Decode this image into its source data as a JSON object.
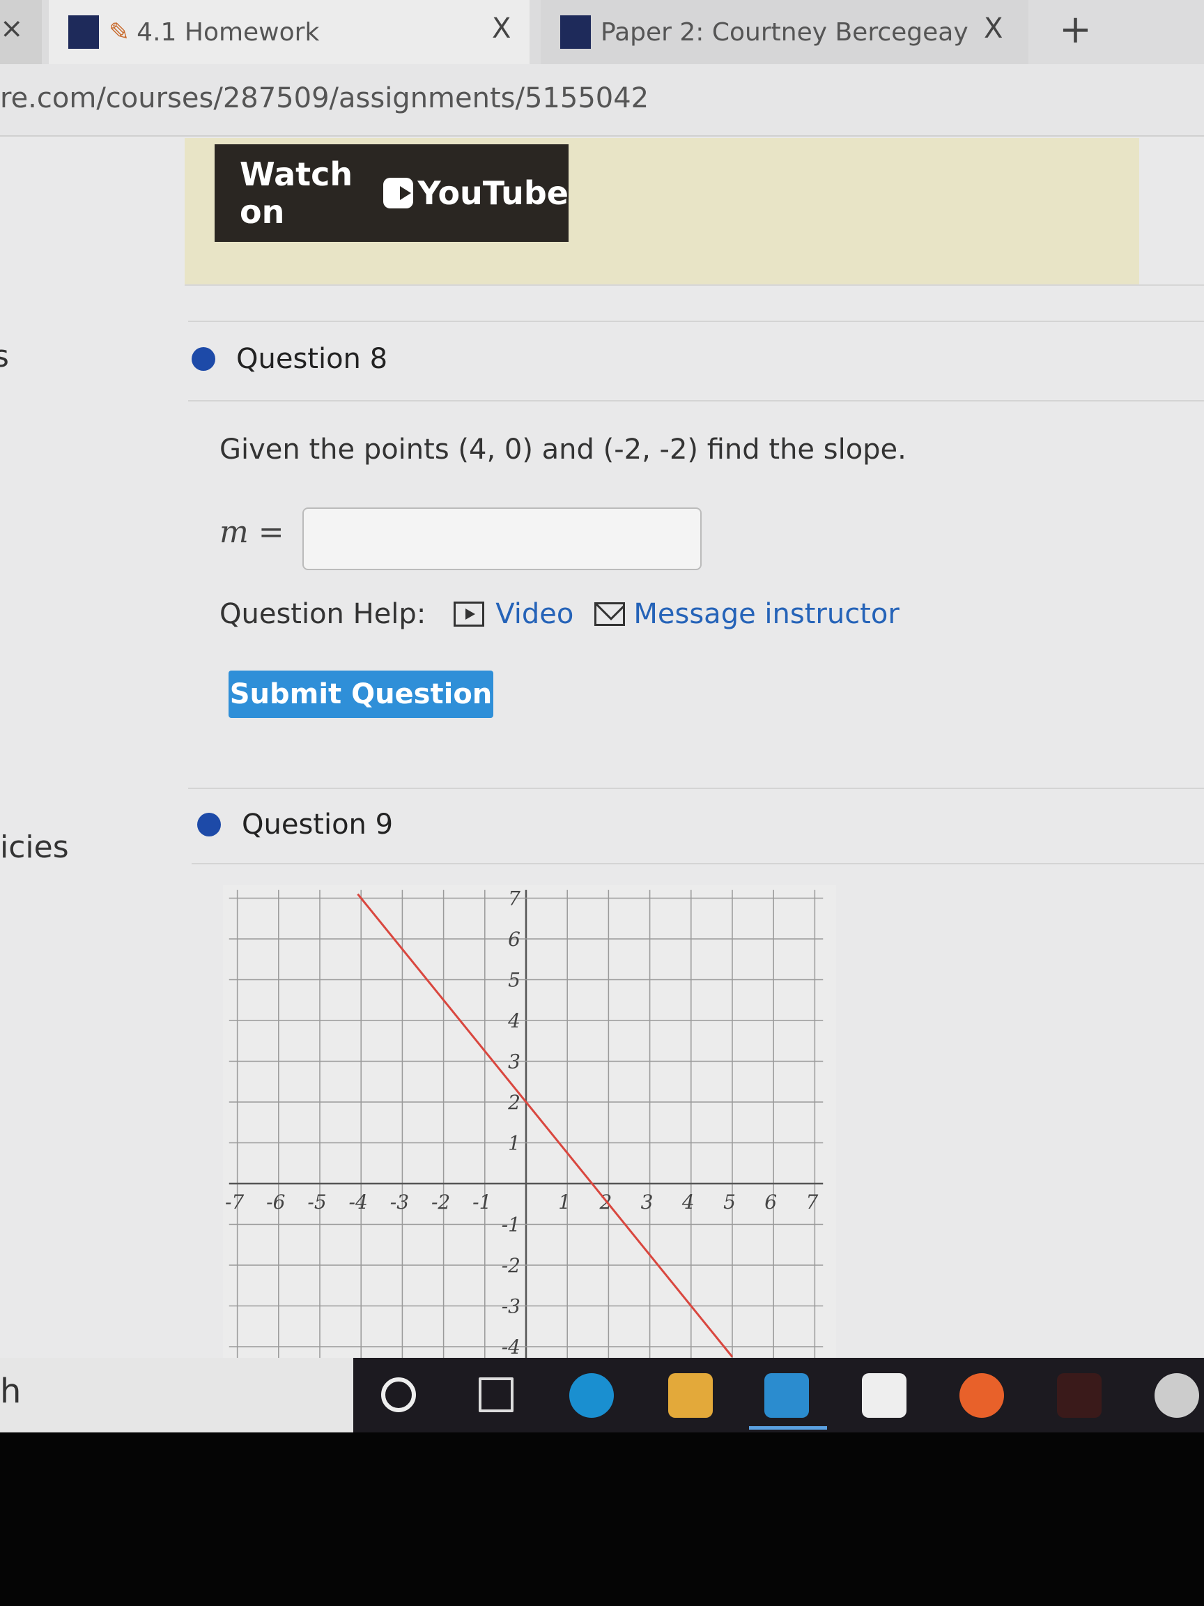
{
  "browser": {
    "tabs": [
      {
        "label": "4.1 Homework",
        "active": true
      },
      {
        "label": "Paper 2: Courtney Bercegeay",
        "active": false
      }
    ],
    "new_tab_label": "+",
    "close_label": "X",
    "url": "re.com/courses/287509/assignments/5155042"
  },
  "video_embed": {
    "watch_label": "Watch on",
    "brand": "YouTube"
  },
  "sidebar": {
    "items": [
      "s",
      "icies",
      "h"
    ]
  },
  "question8": {
    "title": "Question 8",
    "prompt": "Given the points (4, 0) and (-2, -2) find the slope.",
    "answer_label": "m =",
    "answer_value": "",
    "help_label": "Question Help:",
    "video_link": "Video",
    "message_link": "Message instructor",
    "submit_label": "Submit Question"
  },
  "question9": {
    "title": "Question 9"
  },
  "chart_data": {
    "type": "line",
    "xlim": [
      -7,
      7
    ],
    "ylim": [
      -4,
      7
    ],
    "grid": true,
    "x_ticks": [
      "-7",
      "-6",
      "-5",
      "-4",
      "-3",
      "-2",
      "-1",
      "1",
      "2",
      "3",
      "4",
      "5",
      "6",
      "7"
    ],
    "y_ticks": [
      "7",
      "6",
      "5",
      "4",
      "3",
      "2",
      "1",
      "-1",
      "-2",
      "-3",
      "-4"
    ],
    "series": [
      {
        "color": "#d9473f",
        "points": [
          [
            -4,
            7
          ],
          [
            0,
            2
          ],
          [
            4,
            -3
          ]
        ]
      }
    ]
  },
  "colors": {
    "accent": "#2f8fd8",
    "question_dot": "#1d4aa8",
    "link": "#2563b8",
    "graph_line": "#d9473f"
  }
}
